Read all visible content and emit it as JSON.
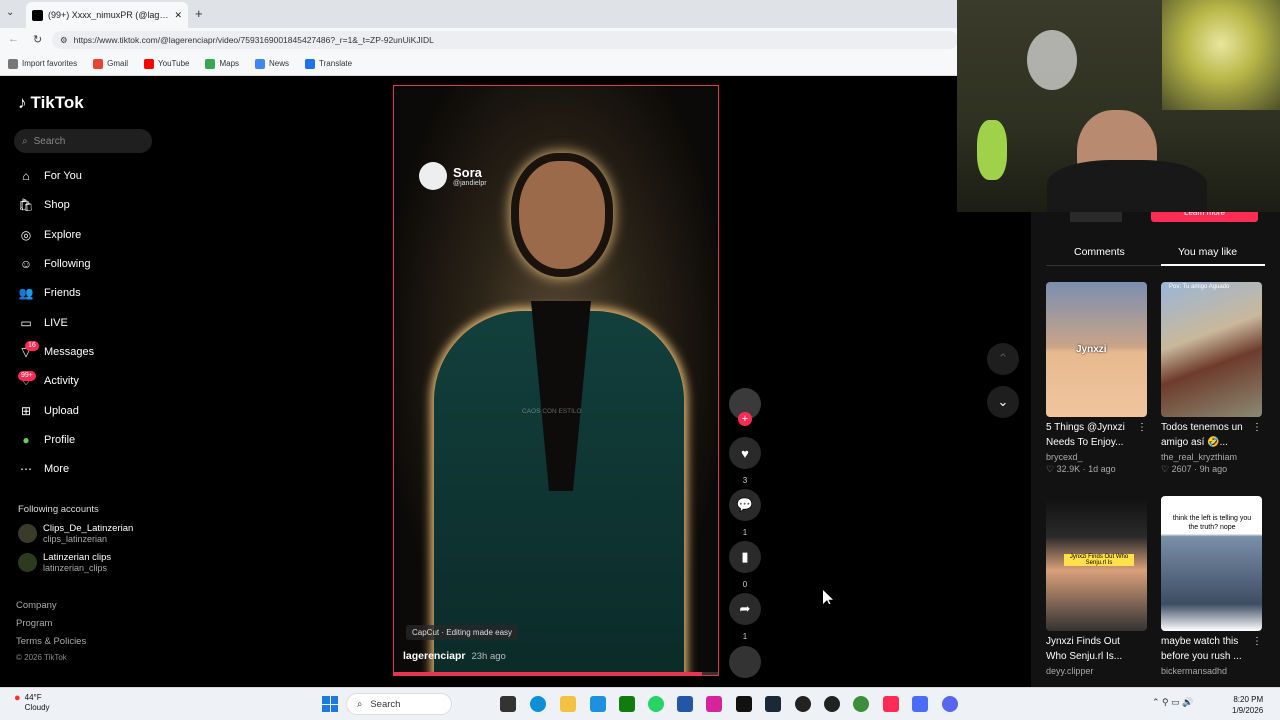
{
  "browser": {
    "tab_title": "(99+) Xxxx_nimuxPR (@lagerenciapr",
    "url": "https://www.tiktok.com/@lagerenciapr/video/7593169001845427486?_r=1&_t=ZP-92unUiKJIDL",
    "bookmarks": [
      "Import favorites",
      "Gmail",
      "YouTube",
      "Maps",
      "News",
      "Translate"
    ]
  },
  "sidebar": {
    "brand": "TikTok",
    "search_placeholder": "Search",
    "items": [
      {
        "label": "For You",
        "icon": "home-icon"
      },
      {
        "label": "Shop",
        "icon": "shop-icon"
      },
      {
        "label": "Explore",
        "icon": "compass-icon"
      },
      {
        "label": "Following",
        "icon": "following-icon"
      },
      {
        "label": "Friends",
        "icon": "friends-icon"
      },
      {
        "label": "LIVE",
        "icon": "live-icon"
      },
      {
        "label": "Messages",
        "icon": "messages-icon",
        "badge": "16"
      },
      {
        "label": "Activity",
        "icon": "activity-icon",
        "badge": "99+"
      },
      {
        "label": "Upload",
        "icon": "upload-icon"
      },
      {
        "label": "Profile",
        "icon": "profile-icon"
      },
      {
        "label": "More",
        "icon": "more-icon"
      }
    ],
    "following_title": "Following accounts",
    "accounts": [
      {
        "name": "Clips_De_Latinzerian",
        "handle": "clips_latinzerian"
      },
      {
        "name": "Latinzerian clips",
        "handle": "latinzerian_clips"
      }
    ],
    "footer": [
      "Company",
      "Program",
      "Terms & Policies",
      "© 2026 TikTok"
    ]
  },
  "video": {
    "sora_label": "Sora",
    "sora_handle": "@jandielpr",
    "watermark": "CAOS CON ESTILO",
    "capcut_tag": "CapCut · Editing made easy",
    "author": "lagerenciapr",
    "posted": "23h ago",
    "progress": 0.95
  },
  "actions": {
    "likes": "3",
    "comments": "1",
    "saves": "0",
    "shares": "1"
  },
  "right_panel": {
    "learn_more": "Learn more",
    "tabs": [
      "Comments",
      "You may like"
    ],
    "cards": [
      {
        "title1": "5 Things @Jynxzi",
        "title2": "Needs To Enjoy...",
        "user": "brycexd_",
        "likes": "32.9K",
        "age": "1d ago",
        "thumb_text": "Jynxzi"
      },
      {
        "title1": "Todos tenemos un",
        "title2": "amigo así 🤣...",
        "user": "the_real_kryzthiam",
        "likes": "2607",
        "age": "9h ago",
        "thumb_text": "Pov: Tu amigo Aguado"
      },
      {
        "title1": "Jynxzi Finds Out",
        "title2": "Who Senju.rl Is...",
        "user": "deyy.clipper",
        "thumb_text": "Jynxzi Finds Out Who Senju.rl Is"
      },
      {
        "title1": "maybe watch this",
        "title2": "before you rush ...",
        "user": "bickermansadhd",
        "thumb_text": "think the left is telling you the truth? nope"
      }
    ]
  },
  "taskbar": {
    "temp": "44°F",
    "weather": "Cloudy",
    "search_label": "Search",
    "time": "8:20 PM",
    "date": "1/9/2026"
  },
  "colors": {
    "accent": "#fe2c55",
    "background": "#000000"
  }
}
